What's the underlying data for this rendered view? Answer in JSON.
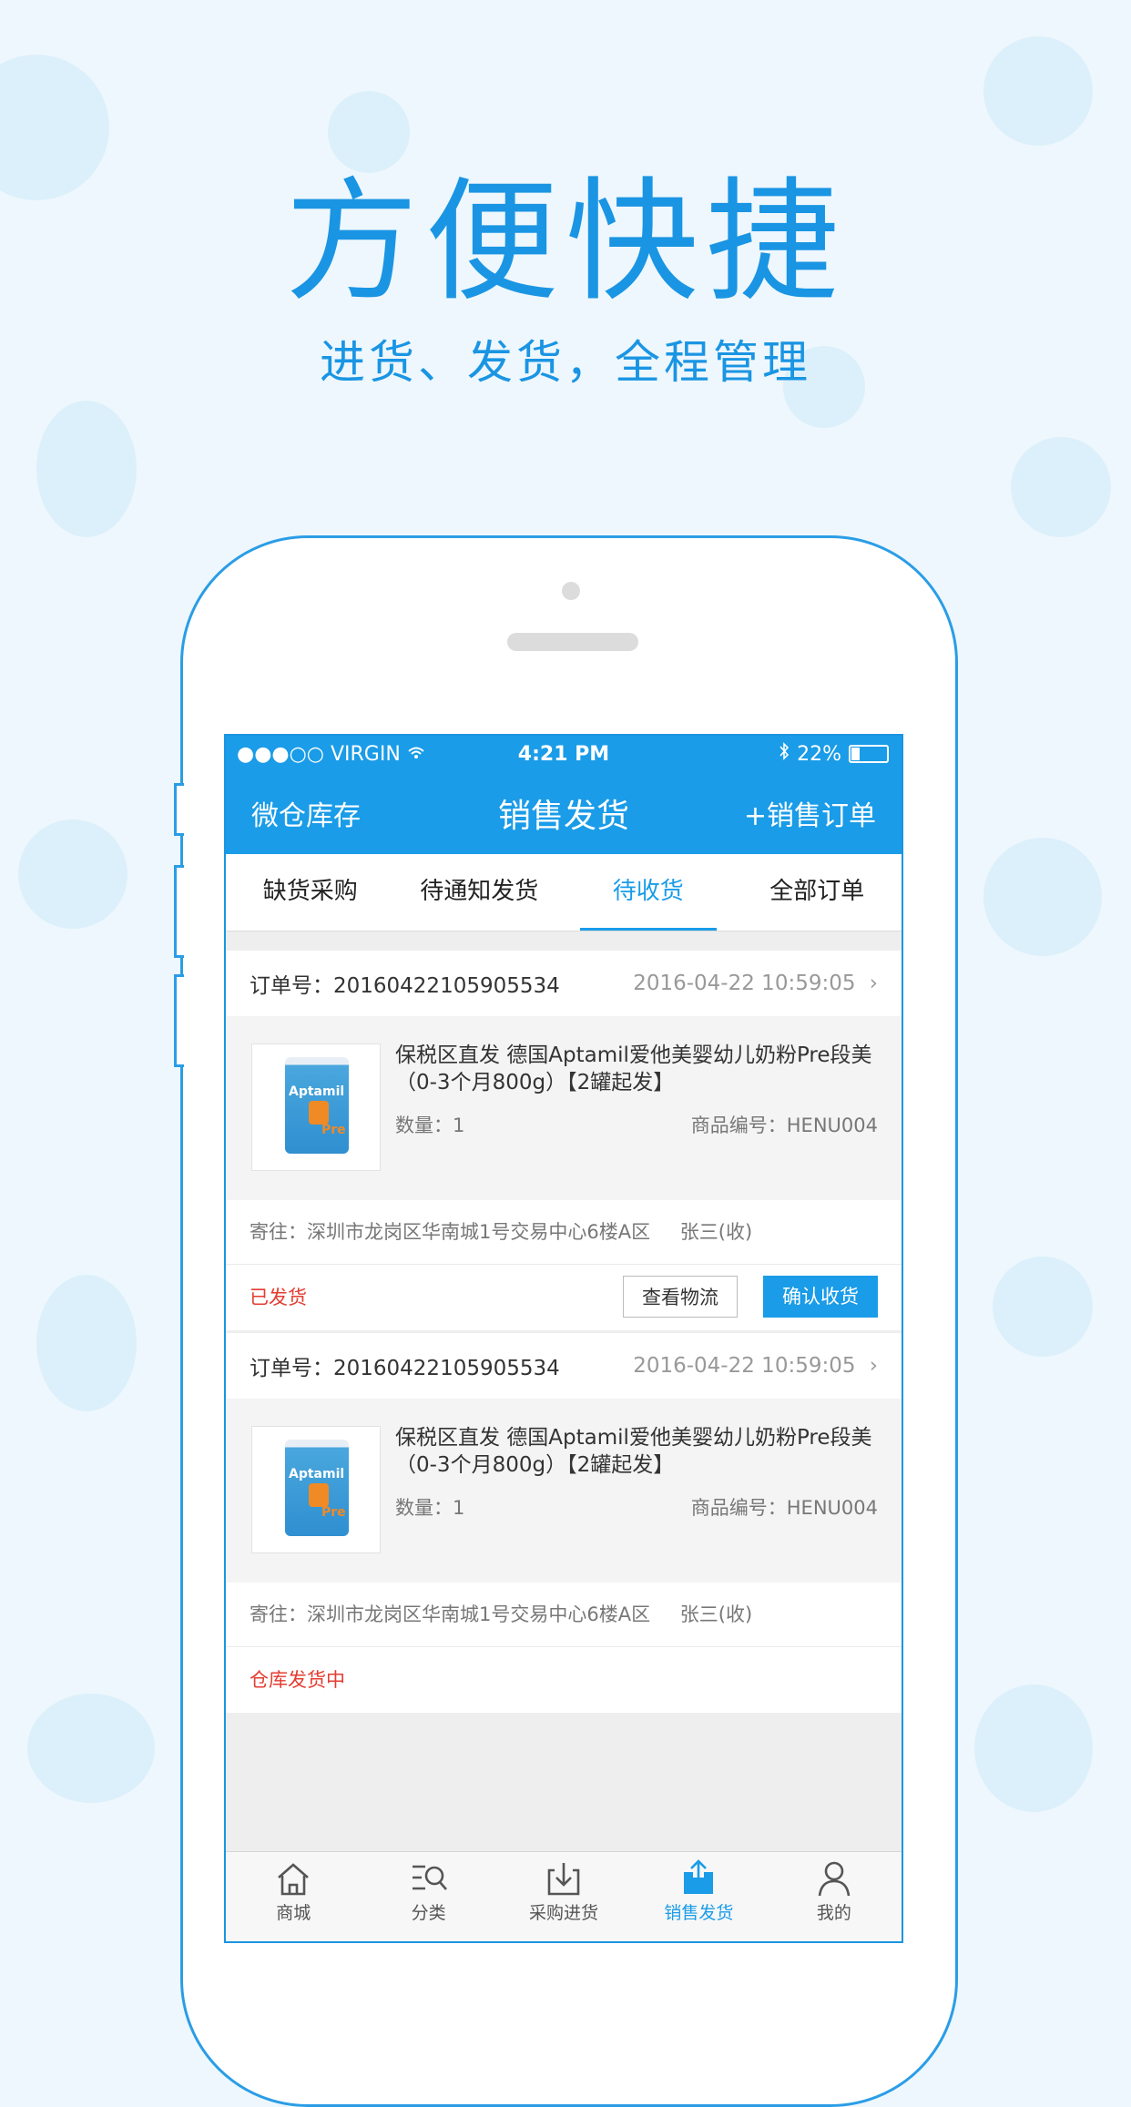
{
  "promo": {
    "headline": "方便快捷",
    "subline": "进货、发货，全程管理"
  },
  "status_bar": {
    "carrier": "●●●○○ VIRGIN",
    "time": "4:21 PM",
    "battery": "22%"
  },
  "navbar": {
    "left": "微仓库存",
    "title": "销售发货",
    "right": "+销售订单"
  },
  "tabs": [
    {
      "label": "缺货采购",
      "active": false
    },
    {
      "label": "待通知发货",
      "active": false
    },
    {
      "label": "待收货",
      "active": true
    },
    {
      "label": "全部订单",
      "active": false
    }
  ],
  "orders": [
    {
      "order_label": "订单号：20160422105905534",
      "time": "2016-04-22 10:59:05",
      "product_name": "保税区直发  德国Aptamil爱他美婴幼儿奶粉Pre段美（0-3个月800g）【2罐起发】",
      "quantity": "数量：1",
      "product_code": "商品编号：HENU004",
      "address": "寄往：深圳市龙岗区华南城1号交易中心6楼A区",
      "recipient": "张三(收)",
      "status": "已发货",
      "buttons": {
        "logistics": "查看物流",
        "confirm": "确认收货"
      }
    },
    {
      "order_label": "订单号：20160422105905534",
      "time": "2016-04-22 10:59:05",
      "product_name": "保税区直发  德国Aptamil爱他美婴幼儿奶粉Pre段美（0-3个月800g）【2罐起发】",
      "quantity": "数量：1",
      "product_code": "商品编号：HENU004",
      "address": "寄往：深圳市龙岗区华南城1号交易中心6楼A区",
      "recipient": "张三(收)",
      "status": "仓库发货中"
    }
  ],
  "product_image": {
    "brand": "Aptamil",
    "stage": "Pre"
  },
  "bottom_nav": [
    {
      "label": "商城",
      "icon": "home-icon",
      "active": false
    },
    {
      "label": "分类",
      "icon": "category-search-icon",
      "active": false
    },
    {
      "label": "采购进货",
      "icon": "download-tray-icon",
      "active": false
    },
    {
      "label": "销售发货",
      "icon": "upload-tray-icon",
      "active": true
    },
    {
      "label": "我的",
      "icon": "user-icon",
      "active": false
    }
  ],
  "colors": {
    "brand_blue": "#1a9ce8",
    "status_red": "#e33c32",
    "background": "#eef7fd"
  }
}
